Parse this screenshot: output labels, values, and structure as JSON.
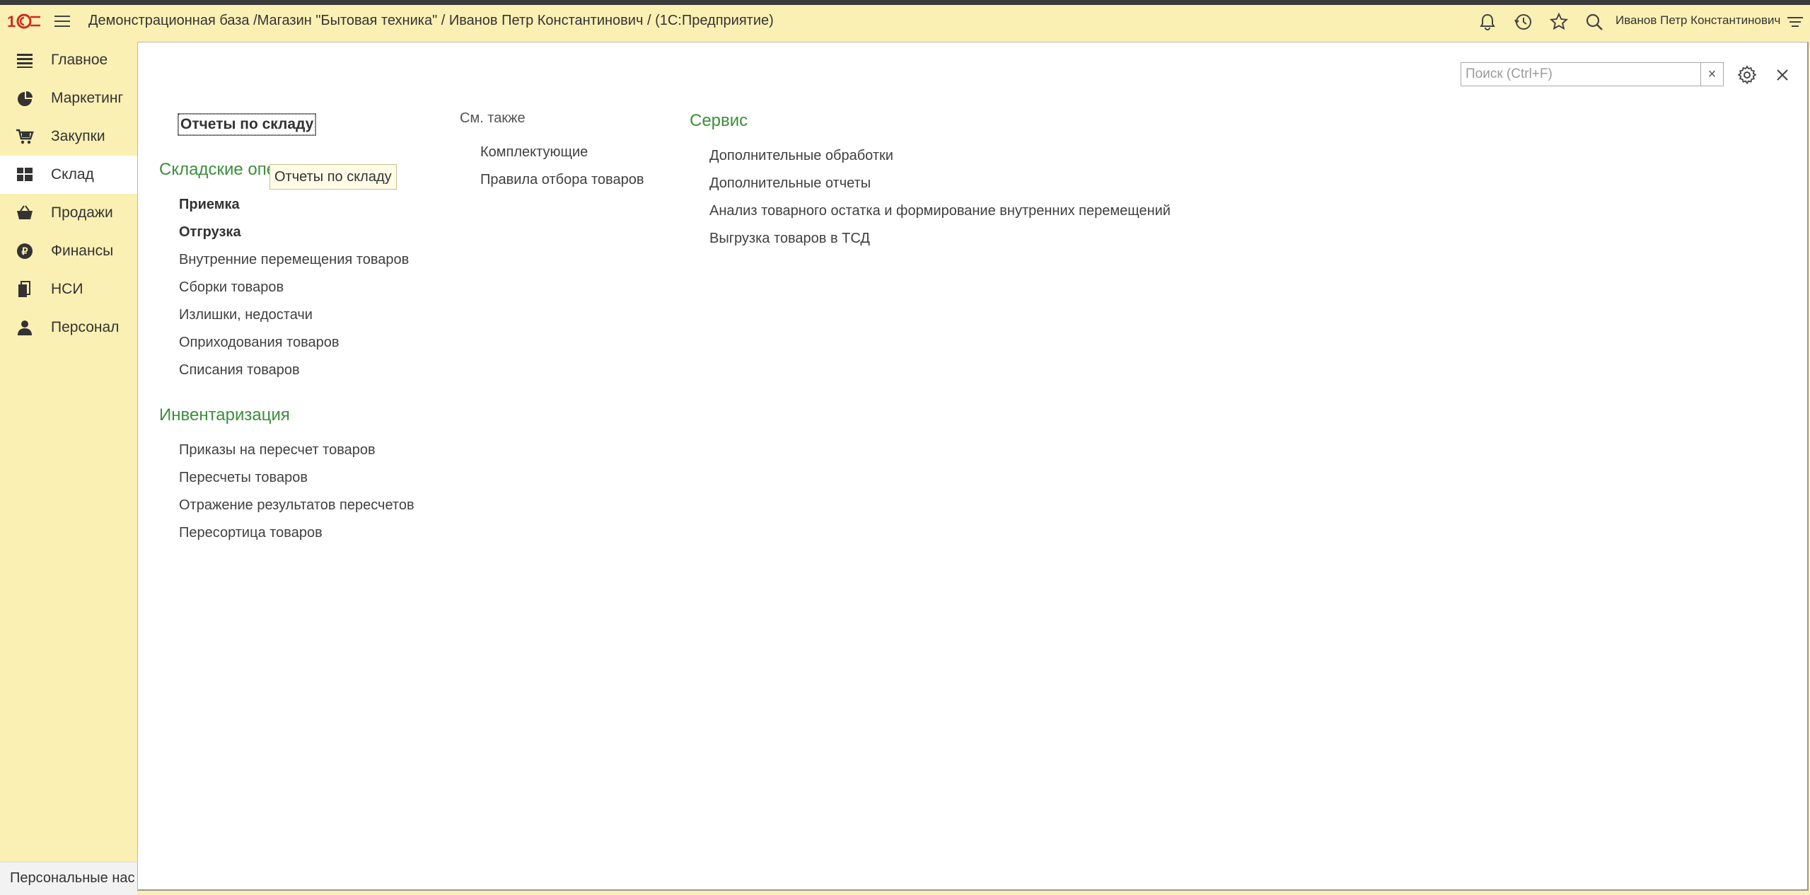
{
  "header": {
    "title": "Демонстрационная база /Магазин \"Бытовая техника\" / Иванов Петр Константинович /  (1С:Предприятие)",
    "user_name": "Иванов Петр Константинович",
    "icons": [
      "logo-1c-icon",
      "menu-icon",
      "bell-icon",
      "history-icon",
      "star-icon",
      "search-icon",
      "settings-lines-icon"
    ]
  },
  "sidebar": {
    "items": [
      {
        "label": "Главное",
        "icon": "list-icon"
      },
      {
        "label": "Маркетинг",
        "icon": "pie-chart-icon"
      },
      {
        "label": "Закупки",
        "icon": "cart-icon"
      },
      {
        "label": "Склад",
        "icon": "warehouse-grid-icon",
        "active": true
      },
      {
        "label": "Продажи",
        "icon": "basket-icon"
      },
      {
        "label": "Финансы",
        "icon": "coin-icon"
      },
      {
        "label": "НСИ",
        "icon": "books-icon"
      },
      {
        "label": "Персонал",
        "icon": "person-icon"
      }
    ]
  },
  "bottom": {
    "personal_settings": "Персональные нас"
  },
  "panel": {
    "search_placeholder": "Поиск (Ctrl+F)",
    "search_clear": "×",
    "focused_link": "Отчеты по складу",
    "tooltip": "Отчеты по складу",
    "groups": {
      "warehouse_ops": {
        "title": "Складские опе",
        "items": [
          "Приемка",
          "Отгрузка",
          "Внутренние перемещения товаров",
          "Сборки товаров",
          "Излишки, недостачи",
          "Оприходования товаров",
          "Списания товаров"
        ]
      },
      "inventory": {
        "title": "Инвентаризация",
        "items": [
          "Приказы на пересчет товаров",
          "Пересчеты товаров",
          "Отражение результатов пересчетов",
          "Пересортица товаров"
        ]
      },
      "see_also": {
        "title": "См. также",
        "items": [
          "Комплектующие",
          "Правила отбора товаров"
        ]
      },
      "service": {
        "title": "Сервис",
        "items": [
          "Дополнительные обработки",
          "Дополнительные отчеты",
          "Анализ товарного остатка и формирование внутренних перемещений",
          "Выгрузка товаров в ТСД"
        ]
      }
    }
  }
}
